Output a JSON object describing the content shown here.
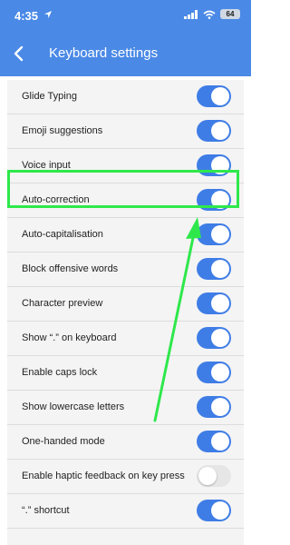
{
  "status_bar": {
    "time": "4:35",
    "battery": "64"
  },
  "header": {
    "title": "Keyboard settings"
  },
  "settings": [
    {
      "label": "Glide Typing",
      "on": true
    },
    {
      "label": "Emoji suggestions",
      "on": true
    },
    {
      "label": "Voice input",
      "on": true
    },
    {
      "label": "Auto-correction",
      "on": true
    },
    {
      "label": "Auto-capitalisation",
      "on": true
    },
    {
      "label": "Block offensive words",
      "on": true
    },
    {
      "label": "Character preview",
      "on": true
    },
    {
      "label": "Show “.” on keyboard",
      "on": true
    },
    {
      "label": "Enable caps lock",
      "on": true
    },
    {
      "label": "Show lowercase letters",
      "on": true
    },
    {
      "label": "One-handed mode",
      "on": true
    },
    {
      "label": "Enable haptic feedback on key press",
      "on": false
    },
    {
      "label": "“.” shortcut",
      "on": true
    }
  ],
  "colors": {
    "accent": "#4a89e6",
    "toggle_on": "#3f7de6",
    "highlight": "#2ee84b"
  }
}
